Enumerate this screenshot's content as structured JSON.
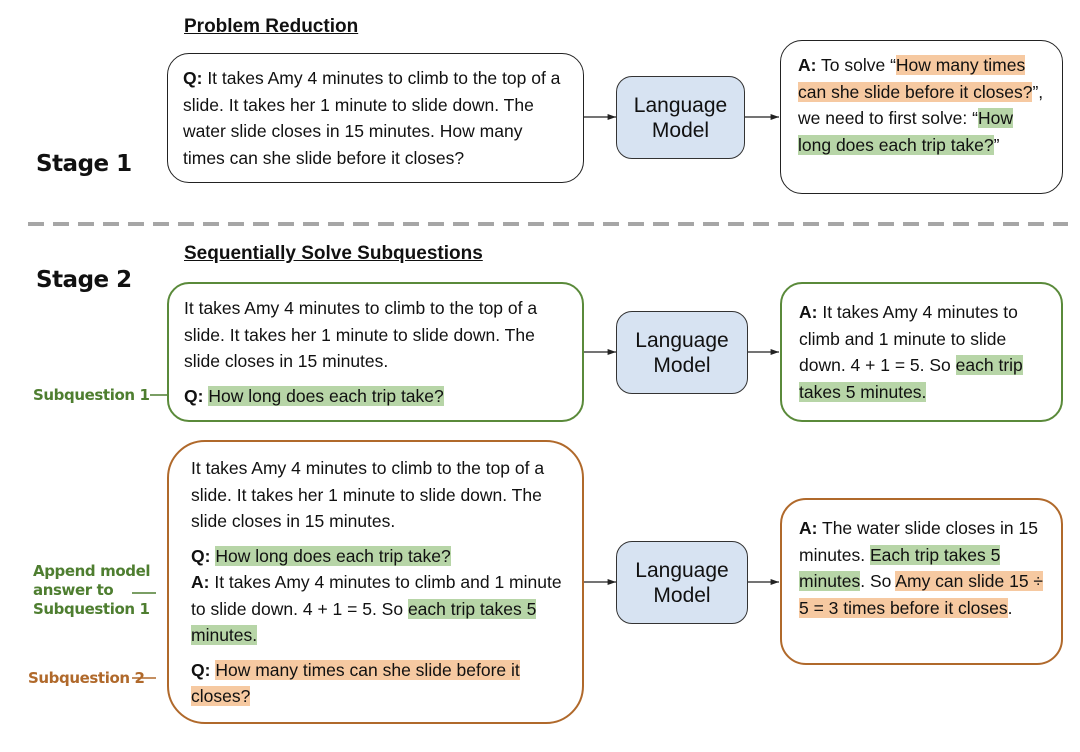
{
  "stage1": {
    "label": "Stage 1",
    "heading": "Problem Reduction",
    "question": {
      "prefix": "Q:",
      "text": " It takes Amy 4 minutes to climb to the top of a slide. It takes her 1 minute to slide down. The water slide closes in 15 minutes. How many times can she slide before it closes?"
    },
    "model_label": "Language Model",
    "answer": {
      "prefix": "A:",
      "t1": " To solve “",
      "h1": "How many times can she slide before it closes?",
      "t2": "”, we need to first solve: “",
      "h2": "How long does each trip take?",
      "t3": "”"
    }
  },
  "stage2": {
    "label": "Stage 2",
    "heading": "Sequentially Solve Subquestions",
    "step1": {
      "context": "It takes Amy 4 minutes to climb to the top of a slide. It takes her 1 minute to slide down. The slide closes in 15 minutes.",
      "q_prefix": "Q:",
      "q_text": "How long does each trip take?",
      "side_label": "Subquestion 1",
      "model_label": "Language Model",
      "answer": {
        "prefix": "A:",
        "t1": " It takes Amy 4 minutes to climb and 1 minute to slide down. 4 + 1 = 5. So ",
        "h1": "each trip takes 5 minutes."
      }
    },
    "step2": {
      "context": "It takes Amy 4 minutes to climb to the top of a slide. It takes her 1 minute to slide down. The slide closes in 15 minutes.",
      "q1_prefix": "Q:",
      "q1_text": "How long does each trip take?",
      "a1_prefix": "A:",
      "a1_text": " It takes Amy 4 minutes to climb and 1 minute to slide down. 4 + 1 = 5. So ",
      "a1_highlight": "each trip takes 5 minutes.",
      "q2_prefix": "Q:",
      "q2_text": "How many times can she slide before it closes?",
      "side_label_append": "Append model answer to Subquestion 1",
      "side_label_sub2": "Subquestion 2",
      "model_label": "Language Model",
      "answer": {
        "prefix": "A:",
        "t1": " The water slide closes in 15 minutes. ",
        "h1": "Each trip takes 5 minutes",
        "t2": ". So ",
        "h2": "Amy can slide 15 ÷ 5 = 3 times before it closes",
        "t3": "."
      }
    }
  },
  "colors": {
    "highlight_orange": "#f6c9a1",
    "highlight_green": "#b7d5a7",
    "border_green": "#5a8a3a",
    "border_orange": "#b0692b",
    "model_fill": "#d7e3f2",
    "divider": "#a6a6a6"
  }
}
